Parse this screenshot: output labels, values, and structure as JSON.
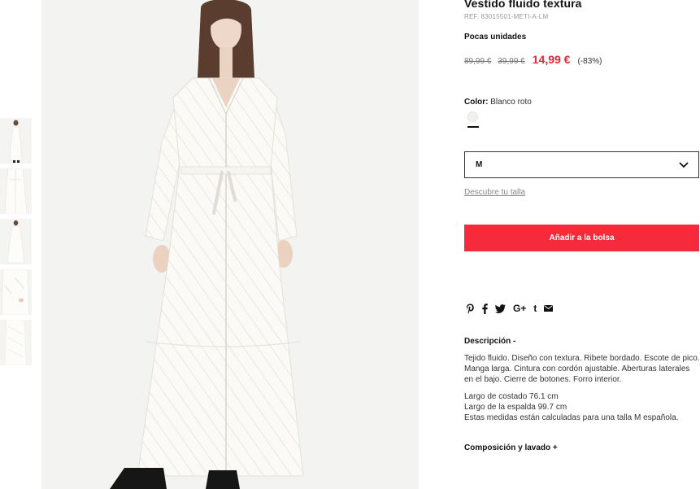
{
  "product": {
    "title": "Vestido fluido textura",
    "ref": "REF. 83015501-METI-A-LM",
    "stock": "Pocas unidades",
    "price_original": "89,99 €",
    "price_previous": "39,99 €",
    "price_current": "14,99 €",
    "discount": "(-83%)"
  },
  "color": {
    "label": "Color:",
    "value": "Blanco roto",
    "swatch_hex": "#f1f1ee"
  },
  "size": {
    "selected": "M",
    "guide_link": "Descubre tu talla"
  },
  "cart": {
    "add_label": "Añadir a la bolsa",
    "button_color": "#f52a3b"
  },
  "share": {
    "icons": [
      "pinterest-icon",
      "facebook-icon",
      "twitter-icon",
      "google-plus-icon",
      "tumblr-icon",
      "email-icon"
    ],
    "google_plus_label": "G+",
    "tumblr_label": "t"
  },
  "description": {
    "heading": "Descripción -",
    "text": "Tejido fluido. Diseño con textura. Ribete bordado. Escote de pico. Manga larga. Cintura con cordón ajustable. Aberturas laterales en el bajo. Cierre de botones. Forro interior.",
    "measures": [
      "Largo de costado 76.1 cm",
      "Largo de la espalda 99.7 cm",
      "Estas medidas están calculadas para una talla M española."
    ]
  },
  "composition": {
    "heading": "Composición y lavado +"
  },
  "colors": {
    "price_sale": "#e22a3a",
    "image_background": "#f3f3f2",
    "dress": "#fbfaf6"
  }
}
